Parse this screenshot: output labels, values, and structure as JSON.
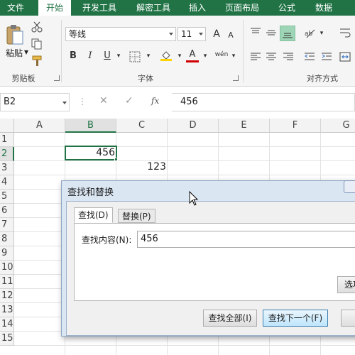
{
  "ribbon": {
    "tabs": [
      {
        "label": "文件"
      },
      {
        "label": "开始"
      },
      {
        "label": "开发工具"
      },
      {
        "label": "解密工具"
      },
      {
        "label": "插入"
      },
      {
        "label": "页面布局"
      },
      {
        "label": "公式"
      },
      {
        "label": "数据"
      }
    ],
    "clipboard": {
      "paste_label": "粘贴",
      "group_label": "剪贴板"
    },
    "font": {
      "name": "等线",
      "size": "11",
      "group_label": "字体",
      "bold": "B",
      "italic": "I",
      "underline": "U",
      "grow": "A",
      "shrink": "A",
      "font_color": "A",
      "phonetic": "wén"
    },
    "alignment": {
      "group_label": "对齐方式"
    }
  },
  "formula_bar": {
    "name_box": "B2",
    "fx": "fx",
    "value": "456"
  },
  "grid": {
    "columns": [
      "A",
      "B",
      "C",
      "D",
      "E",
      "F",
      "G"
    ],
    "rows": [
      "1",
      "2",
      "3",
      "4",
      "5",
      "6",
      "7",
      "8",
      "9",
      "10",
      "11",
      "12",
      "13",
      "14",
      "15"
    ],
    "cells": {
      "B2": "456",
      "C3": "123"
    }
  },
  "dialog": {
    "title": "查找和替换",
    "tabs": {
      "find": "查找(D)",
      "replace": "替换(P)"
    },
    "find_label": "查找内容(N):",
    "find_value": "456",
    "options_button": "选项",
    "find_all_button": "查找全部(I)",
    "find_next_button": "查找下一个(F)"
  },
  "colors": {
    "accent": "#217346",
    "selection": "#217346"
  }
}
